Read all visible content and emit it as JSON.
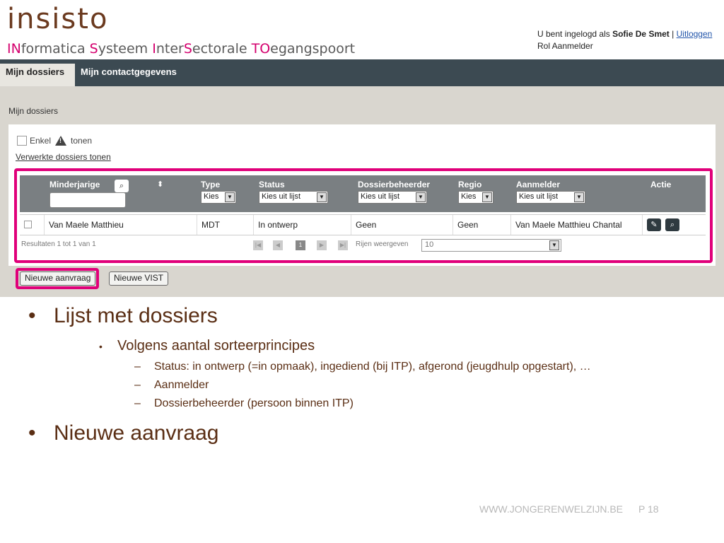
{
  "header": {
    "logo_word": "insisto",
    "logo_sub": [
      {
        "text": "IN",
        "hl": true
      },
      {
        "text": "formatica ",
        "hl": false
      },
      {
        "text": "S",
        "hl": true
      },
      {
        "text": "ysteem ",
        "hl": false
      },
      {
        "text": "I",
        "hl": true
      },
      {
        "text": "nter",
        "hl": false
      },
      {
        "text": "S",
        "hl": true
      },
      {
        "text": "ectorale  ",
        "hl": false
      },
      {
        "text": "TO",
        "hl": true
      },
      {
        "text": "egangspoort",
        "hl": false
      }
    ],
    "logged_in_prefix": "U bent ingelogd als",
    "user_name": "Sofie De Smet",
    "separator": "|",
    "logout_label": "Uitloggen",
    "role_label": "Rol Aanmelder"
  },
  "nav": {
    "tabs": [
      "Mijn dossiers",
      "Mijn contactgegevens"
    ]
  },
  "breadcrumb": "Mijn dossiers",
  "filters": {
    "only_label_before": "Enkel",
    "only_label_after": "tonen",
    "processed_link": "Verwerkte dossiers tonen"
  },
  "table": {
    "headers": [
      "Minderjarige",
      "Type",
      "Status",
      "Dossierbeheerder",
      "Regio",
      "Aanmelder",
      "Actie"
    ],
    "filter_selects": [
      "Kies",
      "Kies uit lijst",
      "Kies uit lijst",
      "Kies",
      "Kies uit lijst"
    ],
    "rows": [
      {
        "minderjarige": "Van Maele Matthieu",
        "type": "MDT",
        "status": "In ontwerp",
        "dossierbeheerder": "Geen",
        "regio": "Geen",
        "aanmelder": "Van Maele Matthieu Chantal"
      }
    ],
    "results_text": "Resultaten 1 tot 1 van 1",
    "current_page": "1",
    "rows_label": "Rijen weergeven",
    "rows_value": "10"
  },
  "buttons": {
    "new_request": "Nieuwe aanvraag",
    "new_vist": "Nieuwe VIST"
  },
  "slide": {
    "bullet1": "Lijst met dossiers",
    "sub1": "Volgens aantal sorteerprincipes",
    "subsub": [
      "Status: in ontwerp (=in opmaak), ingediend (bij ITP), afgerond (jeugdhulp opgestart), …",
      "Aanmelder",
      "Dossierbeheerder (persoon binnen ITP)"
    ],
    "bullet2": "Nieuwe aanvraag"
  },
  "footer": {
    "site": "WWW.JONGERENWELZIJN.BE",
    "page": "P 18"
  },
  "colors": {
    "accent_pink": "#e0007a",
    "brown": "#5a2e14",
    "nav_dark": "#3c4a52"
  },
  "icons": [
    "search-icon",
    "sort-icon",
    "warning-icon",
    "edit-icon",
    "view-icon",
    "first-page-icon",
    "prev-page-icon",
    "next-page-icon",
    "last-page-icon",
    "dropdown-arrow-icon"
  ]
}
